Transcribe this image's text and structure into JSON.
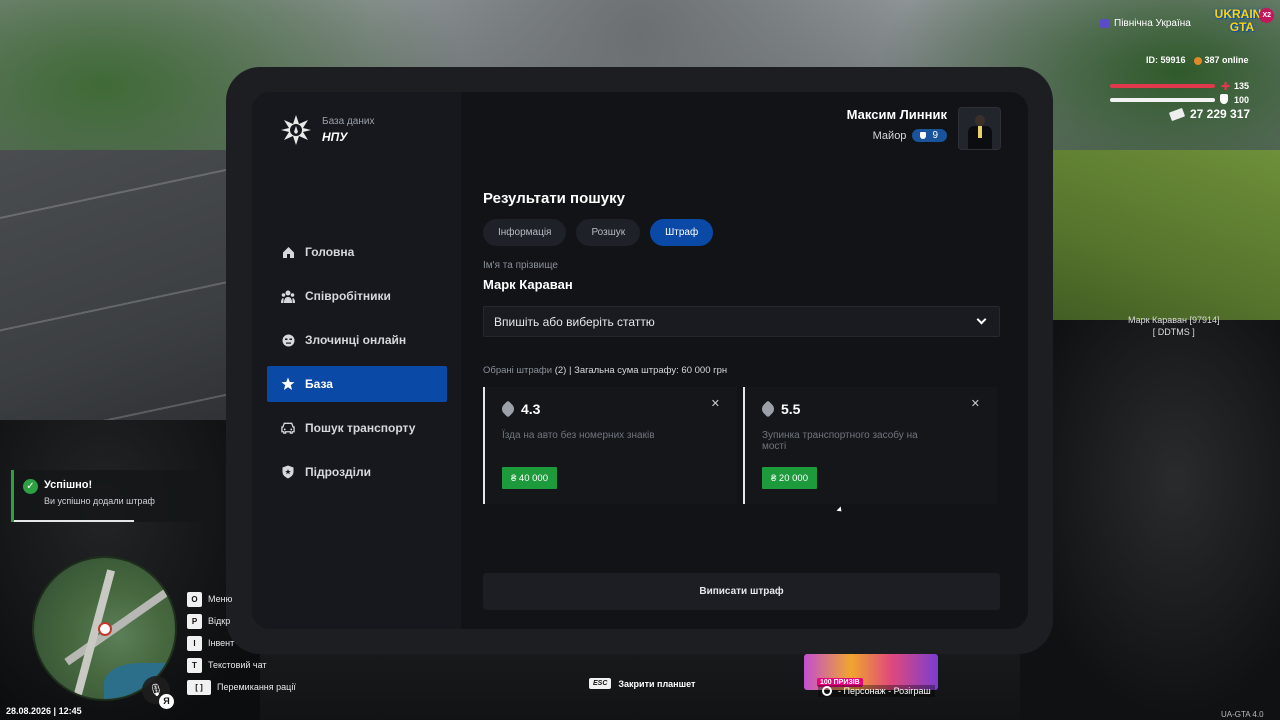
{
  "hud": {
    "region": "Північна Україна",
    "logo_line1": "UKRAINE",
    "logo_line2": "GTA",
    "logo_multiplier": "X2",
    "player_id": "ID: 59916",
    "online": "387 online",
    "health": "135",
    "armor": "100",
    "money": "27 229 317",
    "health_color": "#e2384d"
  },
  "nametag": {
    "name": "Марк Караван [97914]",
    "tag": "[ DDTMS ]"
  },
  "tablet": {
    "brand_subtitle": "База даних",
    "brand_title": "НПУ",
    "profile": {
      "name": "Максим Линник",
      "rank": "Майор",
      "level": "9"
    },
    "nav": [
      {
        "label": "Головна",
        "icon": "home-icon"
      },
      {
        "label": "Співробітники",
        "icon": "users-icon"
      },
      {
        "label": "Злочинці онлайн",
        "icon": "criminal-icon"
      },
      {
        "label": "База",
        "icon": "star-icon",
        "active": true
      },
      {
        "label": "Пошук транспорту",
        "icon": "car-icon"
      },
      {
        "label": "Підрозділи",
        "icon": "shield-icon"
      }
    ],
    "main_title": "Результати пошуку",
    "tabs": [
      {
        "label": "Інформація"
      },
      {
        "label": "Розшук"
      },
      {
        "label": "Штраф",
        "active": true
      }
    ],
    "name_label": "Ім'я та прізвище",
    "name_value": "Марк Караван",
    "article_placeholder": "Впишіть або виберіть статтю",
    "summary_prefix": "Обрані штрафи",
    "summary_count": "(2)",
    "summary_total": "| Загальна сума штрафу: 60 000 грн",
    "fines": [
      {
        "code": "4.3",
        "description": "Їзда на авто без номерних знаків",
        "amount": "₴ 40 000"
      },
      {
        "code": "5.5",
        "description": "Зупинка транспортного засобу на мості",
        "amount": "₴ 20 000"
      }
    ],
    "submit_label": "Виписати штраф",
    "accent_color": "#0b49a6",
    "amount_color": "#1c9a3c"
  },
  "notification": {
    "title": "Успішно!",
    "text": "Ви успішно додали штраф",
    "color": "#2ea043"
  },
  "keybinds": [
    {
      "key": "O",
      "label": "Меню"
    },
    {
      "key": "P",
      "label": "Відкр"
    },
    {
      "key": "I",
      "label": "Інвент"
    },
    {
      "key": "T",
      "label": "Текстовий чат"
    },
    {
      "key": "[ ]",
      "label": "Перемикання рації"
    }
  ],
  "mic_key": "Я",
  "datetime": "28.08.2026 | 12:45",
  "esc_hint": {
    "key": "ESC",
    "label": "Закрити планшет"
  },
  "promo": {
    "badge": "100 ПРИЗІВ",
    "hint": "- Персонаж - Розіграш"
  },
  "version": "UA-GTA 4.0"
}
